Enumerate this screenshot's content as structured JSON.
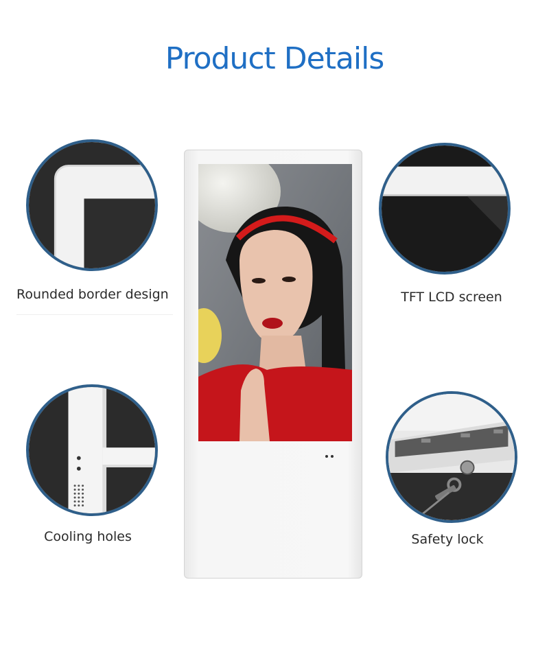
{
  "title": "Product Details",
  "colors": {
    "title": "#1f6fc4",
    "circle_border": "#2f5f8a",
    "label": "#2a2a2a"
  },
  "features": [
    {
      "label": "Rounded border design",
      "icon": "rounded-corner-detail"
    },
    {
      "label": "TFT LCD screen",
      "icon": "lcd-screen-detail"
    },
    {
      "label": "Cooling holes",
      "icon": "cooling-holes-detail"
    },
    {
      "label": "Safety lock",
      "icon": "safety-lock-detail"
    }
  ],
  "product": {
    "name": "floor-standing-digital-signage-kiosk"
  }
}
